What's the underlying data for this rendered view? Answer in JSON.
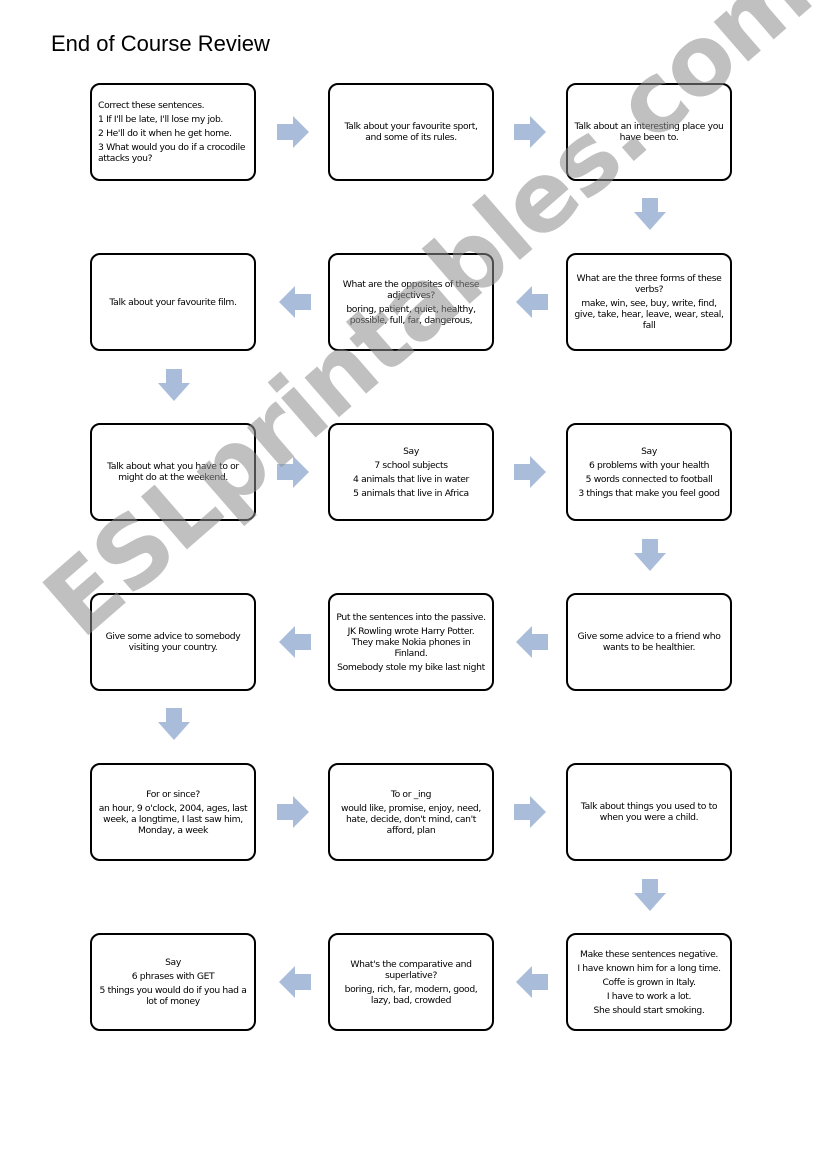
{
  "title": "End of Course Review",
  "colors": {
    "arrow": "#a9bcd9",
    "border": "#000000",
    "watermark": "#8c8c8c"
  },
  "watermark": "ESLprintables.com",
  "cards": [
    {
      "id": 1,
      "lines": [
        "Correct these sentences.",
        "1 If I'll be late, I'll lose my job.",
        "2 He'll do it when he get home.",
        "3 What would you do if a crocodile attacks you?"
      ]
    },
    {
      "id": 2,
      "lines": [
        "Talk about your favourite sport, and some of its rules."
      ]
    },
    {
      "id": 3,
      "lines": [
        "Talk about an interesting place you have been to."
      ]
    },
    {
      "id": 4,
      "lines": [
        "What are the three forms of these verbs?",
        "make, win, see, buy, write, find, give, take, hear, leave, wear, steal, fall"
      ]
    },
    {
      "id": 5,
      "lines": [
        "What are the opposites of these adjectives?",
        "boring, patient, quiet, healthy, possible, full, far, dangerous,"
      ]
    },
    {
      "id": 6,
      "lines": [
        "Talk about your favourite film."
      ]
    },
    {
      "id": 7,
      "lines": [
        "Talk about what you have to or might do at the weekend."
      ]
    },
    {
      "id": 8,
      "lines": [
        "Say",
        "7 school subjects",
        "4 animals that live in water",
        "5 animals that live in Africa"
      ]
    },
    {
      "id": 9,
      "lines": [
        "Say",
        "6 problems with your health",
        "5 words connected to football",
        "3 things that make you feel good"
      ]
    },
    {
      "id": 10,
      "lines": [
        "Give some advice to a friend who wants to be healthier."
      ]
    },
    {
      "id": 11,
      "lines": [
        "Put the sentences into the passive.",
        "JK Rowling wrote Harry Potter. They make Nokia phones in Finland.",
        "Somebody stole my bike last night"
      ]
    },
    {
      "id": 12,
      "lines": [
        "Give some advice to somebody visiting your country."
      ]
    },
    {
      "id": 13,
      "lines": [
        "For or since?",
        "an hour, 9 o'clock, 2004, ages, last week, a longtime, I last saw him, Monday, a week"
      ]
    },
    {
      "id": 14,
      "lines": [
        "To or _ing",
        "would like, promise, enjoy, need, hate, decide, don't mind, can't afford, plan"
      ]
    },
    {
      "id": 15,
      "lines": [
        "Talk about things you used to to when you were a child."
      ]
    },
    {
      "id": 16,
      "lines": [
        "Make these sentences negative.",
        "I have known him for a long time.",
        "Coffe is grown in Italy.",
        "I have to work a lot.",
        "She should start smoking."
      ]
    },
    {
      "id": 17,
      "lines": [
        "What's the comparative and superlative?",
        "boring, rich, far, modern, good, lazy, bad, crowded"
      ]
    },
    {
      "id": 18,
      "lines": [
        "Say",
        "6 phrases with GET",
        "5 things you would do if you had a lot of money"
      ]
    }
  ],
  "arrows": [
    {
      "from": 1,
      "to": 2,
      "direction": "right"
    },
    {
      "from": 2,
      "to": 3,
      "direction": "right"
    },
    {
      "from": 3,
      "to": 4,
      "direction": "down"
    },
    {
      "from": 4,
      "to": 5,
      "direction": "left"
    },
    {
      "from": 5,
      "to": 6,
      "direction": "left"
    },
    {
      "from": 6,
      "to": 7,
      "direction": "down"
    },
    {
      "from": 7,
      "to": 8,
      "direction": "right"
    },
    {
      "from": 8,
      "to": 9,
      "direction": "right"
    },
    {
      "from": 9,
      "to": 10,
      "direction": "down"
    },
    {
      "from": 10,
      "to": 11,
      "direction": "left"
    },
    {
      "from": 11,
      "to": 12,
      "direction": "left"
    },
    {
      "from": 12,
      "to": 13,
      "direction": "down"
    },
    {
      "from": 13,
      "to": 14,
      "direction": "right"
    },
    {
      "from": 14,
      "to": 15,
      "direction": "right"
    },
    {
      "from": 15,
      "to": 16,
      "direction": "down"
    },
    {
      "from": 16,
      "to": 17,
      "direction": "left"
    },
    {
      "from": 17,
      "to": 18,
      "direction": "left"
    }
  ]
}
